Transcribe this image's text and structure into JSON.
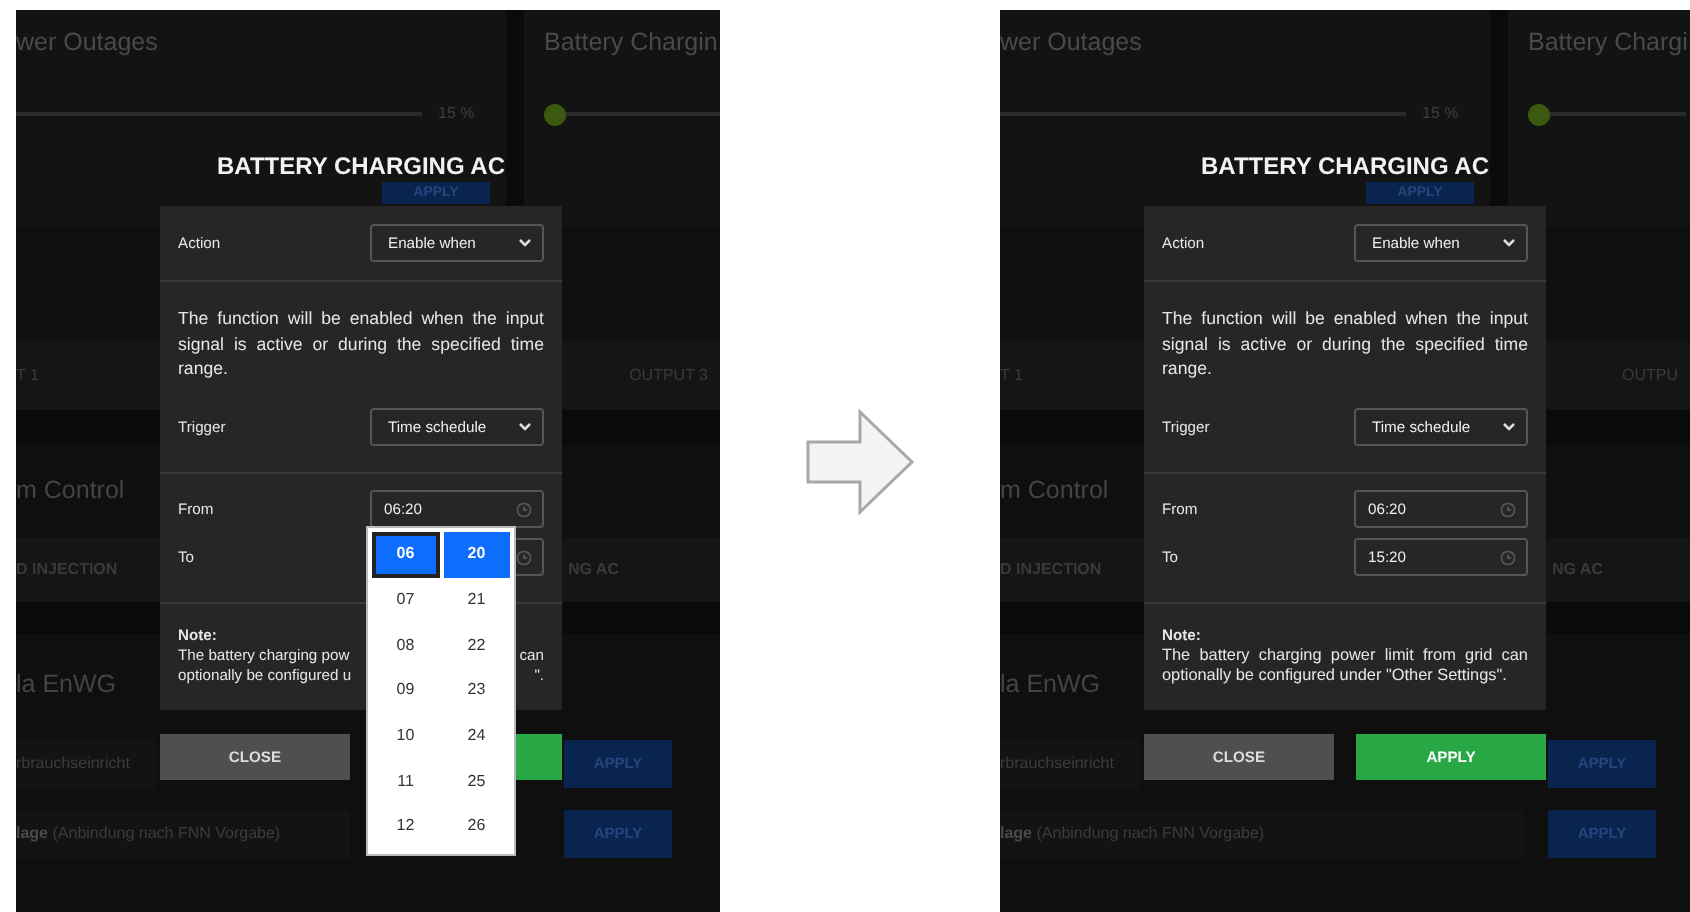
{
  "panels": [
    {
      "background": {
        "cards": [
          {
            "title": "wer Outages",
            "reading": "15 %",
            "button": "APPLY"
          },
          {
            "title": "Battery Chargin",
            "level": 0
          }
        ],
        "outputs": [
          "T 1",
          "OUTPUT 3"
        ],
        "section_title": "m Control",
        "functions": [
          "D INJECTION",
          "NG AC"
        ],
        "enwg_title": "la EnWG",
        "enwg_rows": [
          {
            "text": "rbrauchseinricht",
            "button": "APPLY"
          },
          {
            "text": "**lage** (Anbindung nach FNN Vorgabe)",
            "button": "APPLY"
          }
        ]
      },
      "modal": {
        "title": "BATTERY CHARGING AC",
        "action": {
          "label": "Action",
          "value": "Enable when"
        },
        "description": "The function will be enabled when the input signal is active or during the specified time range.",
        "trigger": {
          "label": "Trigger",
          "value": "Time schedule"
        },
        "from": {
          "label": "From",
          "value": "06:20"
        },
        "to": {
          "label": "To"
        },
        "note": {
          "title": "Note:",
          "fragments": [
            {
              "start": "The battery charging pow",
              "end": "can"
            },
            {
              "start": "optionally be configured u",
              "end": "\"."
            }
          ]
        },
        "buttons": [
          {
            "kind": "close",
            "label": "CLOSE"
          },
          {
            "kind": "apply"
          }
        ]
      },
      "time_picker": {
        "columns": [
          {
            "items": [
              {
                "text": "06",
                "selected": true
              },
              {
                "text": "07",
                "selected": false
              },
              {
                "text": "08",
                "selected": false
              },
              {
                "text": "09",
                "selected": false
              },
              {
                "text": "10",
                "selected": false
              },
              {
                "text": "11",
                "selected": false
              },
              {
                "text": "12",
                "selected": false
              }
            ]
          },
          {
            "items": [
              {
                "text": "20",
                "selected": true
              },
              {
                "text": "21",
                "selected": false
              },
              {
                "text": "22",
                "selected": false
              },
              {
                "text": "23",
                "selected": false
              },
              {
                "text": "24",
                "selected": false
              },
              {
                "text": "25",
                "selected": false
              },
              {
                "text": "26",
                "selected": false
              }
            ]
          }
        ]
      }
    },
    {
      "background": {
        "cards": [
          {
            "title": "wer Outages",
            "reading": "15 %",
            "button": "APPLY"
          },
          {
            "title": "Battery Chargi",
            "level": 0
          }
        ],
        "outputs": [
          "T 1",
          "OUTPU"
        ],
        "section_title": "m Control",
        "functions": [
          "D INJECTION",
          "NG AC"
        ],
        "enwg_title": "la EnWG",
        "enwg_rows": [
          {
            "text": "rbrauchseinricht",
            "button": "APPLY"
          },
          {
            "text": "**lage** (Anbindung nach FNN Vorgabe)",
            "button": "APPLY"
          }
        ]
      },
      "modal": {
        "title": "BATTERY CHARGING AC",
        "action": {
          "label": "Action",
          "value": "Enable when"
        },
        "description": "The function will be enabled when the input signal is active or during the specified time range.",
        "trigger": {
          "label": "Trigger",
          "value": "Time schedule"
        },
        "from": {
          "label": "From",
          "value": "06:20"
        },
        "to": {
          "label": "To",
          "value": "15:20"
        },
        "note": {
          "title": "Note:",
          "text": "The battery charging power limit from grid can optionally be configured under \"Other Settings\"."
        },
        "buttons": [
          {
            "kind": "close",
            "label": "CLOSE"
          },
          {
            "kind": "apply",
            "label": "APPLY"
          }
        ]
      }
    }
  ]
}
